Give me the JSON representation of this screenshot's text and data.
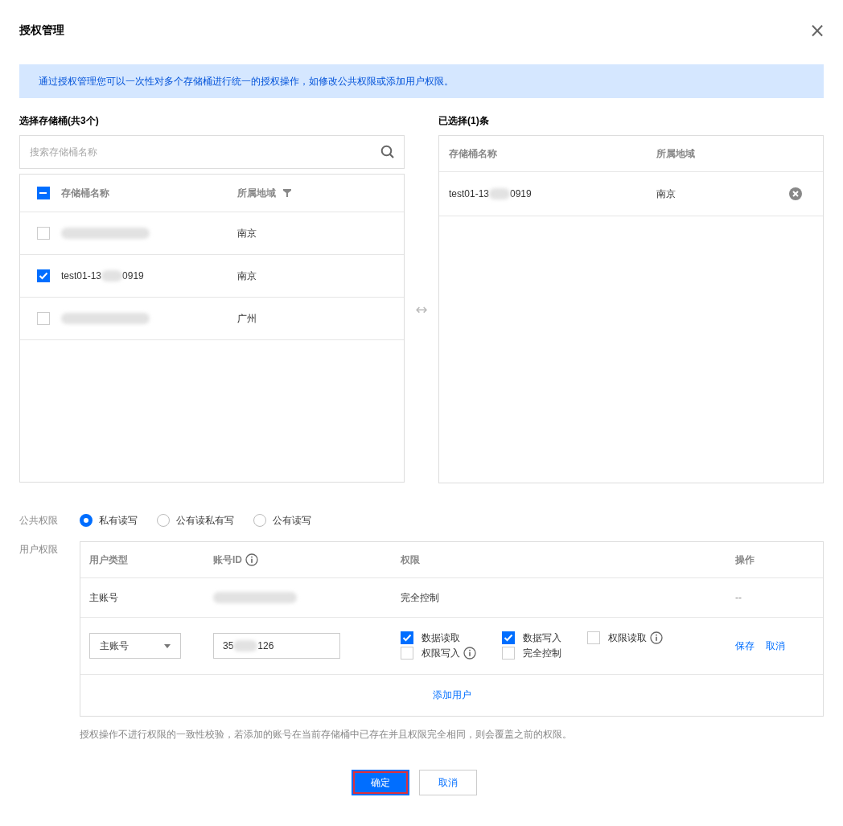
{
  "dialog": {
    "title": "授权管理",
    "close": "×"
  },
  "notice": "通过授权管理您可以一次性对多个存储桶进行统一的授权操作，如修改公共权限或添加用户权限。",
  "source": {
    "title": "选择存储桶(共3个)",
    "search": {
      "placeholder": "搜索存储桶名称"
    },
    "indeterminate": true,
    "columns": [
      "存储桶名称",
      "所属地域"
    ],
    "rows": [
      {
        "redacted": true,
        "region": "南京",
        "checked": false
      },
      {
        "name_start": "test01-13",
        "name_end": "0919",
        "redacted": true,
        "region": "南京",
        "checked": true
      },
      {
        "redacted": true,
        "region": "广州",
        "checked": false
      }
    ]
  },
  "transfer": "↔",
  "selected": {
    "title": "已选择(1)条",
    "columns": [
      "存储桶名称",
      "所属地域"
    ],
    "rows": [
      {
        "name_start": "test01-13",
        "name_end": "0919",
        "redacted": true,
        "region": "南京"
      }
    ]
  },
  "public_permission": {
    "label": "公共权限",
    "options": [
      {
        "label": "私有读写",
        "selected": true
      },
      {
        "label": "公有读私有写",
        "selected": false
      },
      {
        "label": "公有读写",
        "selected": false
      }
    ]
  },
  "user_permission": {
    "label": "用户权限",
    "columns": [
      "用户类型",
      "账号ID",
      "权限",
      "操作"
    ],
    "rows": [
      {
        "kind": "static",
        "user_type": "主账号",
        "account_redacted": true,
        "permission": "完全控制",
        "action": "--"
      },
      {
        "kind": "edit",
        "user_type": "主账号",
        "account_start": "35",
        "account_end": "126",
        "account_redacted": true,
        "permissions": [
          {
            "label": "数据读取",
            "checked": true,
            "info": false
          },
          {
            "label": "数据写入",
            "checked": true,
            "info": false
          },
          {
            "label": "权限读取",
            "checked": false,
            "info": true
          },
          {
            "label": "权限写入",
            "checked": false,
            "info": true
          },
          {
            "label": "完全控制",
            "checked": false,
            "info": false
          }
        ],
        "actions": [
          "保存",
          "取消"
        ]
      }
    ],
    "add_user": "添加用户"
  },
  "note": "授权操作不进行权限的一致性校验，若添加的账号在当前存储桶中已存在并且权限完全相同，则会覆盖之前的权限。",
  "buttons": [
    {
      "label": "确定",
      "kind": "primary",
      "highlighted": true
    },
    {
      "label": "取消",
      "kind": "secondary",
      "highlighted": false
    }
  ]
}
